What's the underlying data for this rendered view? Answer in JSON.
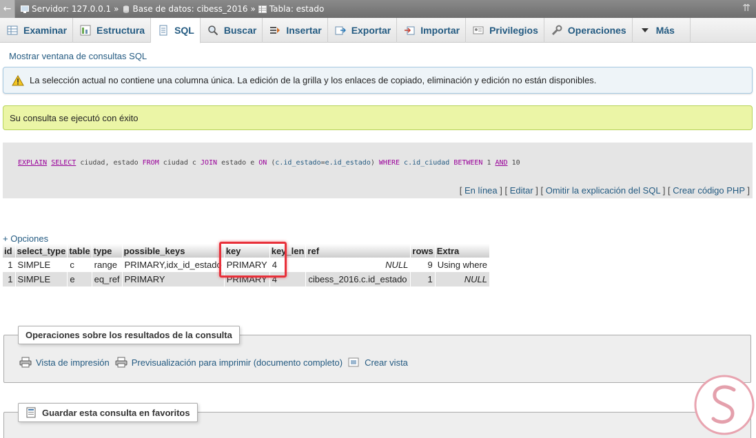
{
  "breadcrumb": {
    "back": "←",
    "server": "Servidor: 127.0.0.1",
    "database": "Base de datos: cibess_2016",
    "table": "Tabla: estado",
    "sep": "»",
    "collapse": "⇈"
  },
  "tabs": [
    {
      "label": "Examinar",
      "icon": "browse-icon",
      "active": false
    },
    {
      "label": "Estructura",
      "icon": "structure-icon",
      "active": false
    },
    {
      "label": "SQL",
      "icon": "sql-icon",
      "active": true
    },
    {
      "label": "Buscar",
      "icon": "search-icon",
      "active": false
    },
    {
      "label": "Insertar",
      "icon": "insert-icon",
      "active": false
    },
    {
      "label": "Exportar",
      "icon": "export-icon",
      "active": false
    },
    {
      "label": "Importar",
      "icon": "import-icon",
      "active": false
    },
    {
      "label": "Privilegios",
      "icon": "privileges-icon",
      "active": false
    },
    {
      "label": "Operaciones",
      "icon": "wrench-icon",
      "active": false
    },
    {
      "label": "Más",
      "icon": "caret-down-icon",
      "active": false
    }
  ],
  "sql_window_link": "Mostrar ventana de consultas SQL",
  "warning": "La selección actual no contiene una columna única. La edición de la grilla y los enlaces de copiado, eliminación y edición no están disponibles.",
  "success": "Su consulta se ejecutó con éxito",
  "query": {
    "kw_explain": "EXPLAIN",
    "kw_select": "SELECT",
    "cols": " ciudad, estado ",
    "kw_from": "FROM",
    "t1": " ciudad c ",
    "kw_join": "JOIN",
    "t2": " estado e ",
    "kw_on": "ON",
    "on_open": " (",
    "on_left": "c.id_estado",
    "on_eq": "=",
    "on_right": "e.id_estado",
    "on_close": ") ",
    "kw_where": "WHERE",
    "where_sp": " ",
    "where_col": "c.id_ciudad",
    "between_sp": " ",
    "kw_between": "BETWEEN",
    "n1": " 1 ",
    "kw_and": "AND",
    "n2": " 10"
  },
  "query_links": {
    "open": "[ ",
    "inline": "En línea",
    "sep": " ] [ ",
    "edit": "Editar",
    "skip": "Omitir la explicación del SQL",
    "php": "Crear código PHP",
    "close": " ]"
  },
  "options_link": "+ Opciones",
  "results": {
    "headers": [
      "id",
      "select_type",
      "table",
      "type",
      "possible_keys",
      "key",
      "key_len",
      "ref",
      "rows",
      "Extra"
    ],
    "rows": [
      [
        "1",
        "SIMPLE",
        "c",
        "range",
        "PRIMARY,idx_id_estado",
        "PRIMARY",
        "4",
        "NULL",
        "9",
        "Using where"
      ],
      [
        "1",
        "SIMPLE",
        "e",
        "eq_ref",
        "PRIMARY",
        "PRIMARY",
        "4",
        "cibess_2016.c.id_estado",
        "1",
        "NULL"
      ]
    ]
  },
  "query_ops": {
    "title": "Operaciones sobre los resultados de la consulta",
    "print_view": "Vista de impresión",
    "print_preview": "Previsualización para imprimir (documento completo)",
    "create_view": "Crear vista"
  },
  "bookmark": {
    "title": "Guardar esta consulta en favoritos"
  },
  "colors": {
    "link": "#235a81",
    "highlight": "#e8303a",
    "success_bg": "#ebf5a6",
    "warning_bg": "#eef4f8"
  }
}
